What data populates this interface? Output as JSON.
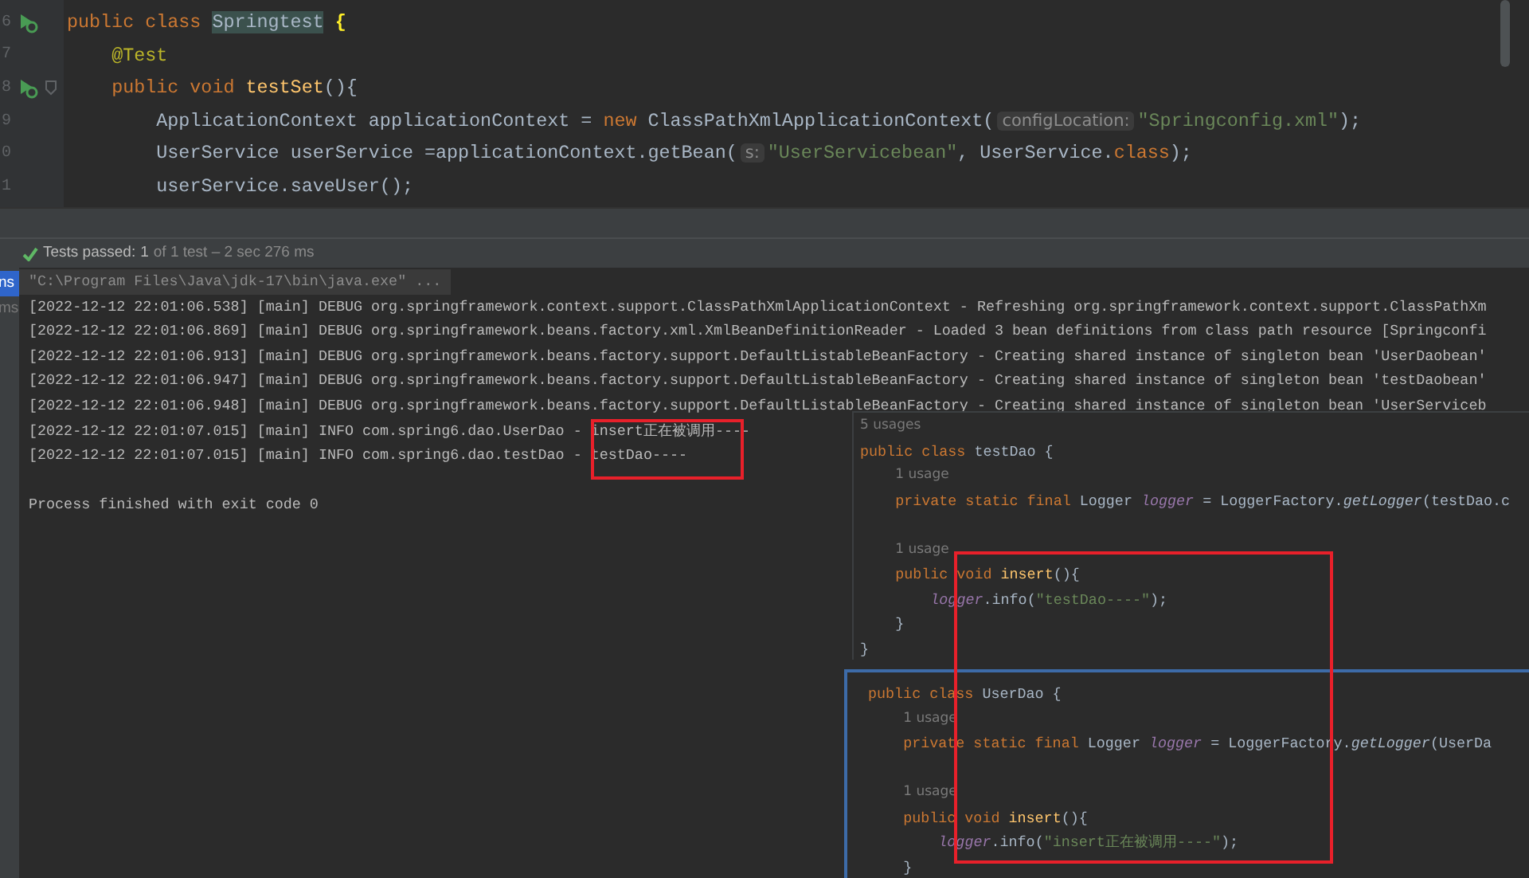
{
  "editor": {
    "lines": [
      {
        "number": "6",
        "run_marker": true,
        "fold": false,
        "tokens": [
          {
            "kind": "keyword",
            "text": "public class "
          },
          {
            "kind": "highlight",
            "text": "Springtest"
          },
          {
            "kind": "brace",
            "text": "{"
          }
        ],
        "children": [
          {
            "number": "7",
            "run_marker": false,
            "fold": false,
            "tokens": [
              {
                "kind": "annotation",
                "text": "@Test"
              }
            ]
          },
          {
            "number": "8",
            "run_marker": true,
            "fold": true,
            "tokens": [
              {
                "kind": "keyword",
                "text": "public void "
              },
              {
                "kind": "declaration",
                "text": "testSet"
              },
              {
                "kind": "plain",
                "text": "(){"
              }
            ],
            "children": [
              {
                "number": "9",
                "run_marker": false,
                "fold": false,
                "tokens": [
                  {
                    "kind": "plain",
                    "text": "ApplicationContext applicationContext = "
                  },
                  {
                    "kind": "keyword",
                    "text": "new "
                  },
                  {
                    "kind": "plain",
                    "text": "ClassPathXmlApplicationContext("
                  },
                  {
                    "kind": "hint",
                    "text": "configLocation:"
                  },
                  {
                    "kind": "string",
                    "text": "\"Springconfig.xml\""
                  },
                  {
                    "kind": "plain",
                    "text": ");"
                  }
                ]
              },
              {
                "number": "0",
                "run_marker": false,
                "fold": false,
                "tokens": [
                  {
                    "kind": "plain",
                    "text": "UserService userService =applicationContext.getBean("
                  },
                  {
                    "kind": "hint",
                    "text": "s:"
                  },
                  {
                    "kind": "string",
                    "text": "\"UserServicebean\""
                  },
                  {
                    "kind": "plain",
                    "text": ", UserService."
                  },
                  {
                    "kind": "keyword",
                    "text": "class"
                  },
                  {
                    "kind": "plain",
                    "text": ");"
                  }
                ]
              },
              {
                "number": "1",
                "run_marker": false,
                "fold": false,
                "tokens": [
                  {
                    "kind": "plain",
                    "text": "userService.saveUser();"
                  }
                ]
              }
            ]
          }
        ]
      }
    ]
  },
  "test_status": {
    "passed": true,
    "label": "Tests passed:",
    "count": "1",
    "detail": "of 1 test – 2 sec 276 ms"
  },
  "tree": [
    {
      "text": "ns",
      "selected": true
    },
    {
      "text": "ms",
      "selected": false
    }
  ],
  "console": [
    {
      "kind": "command",
      "text": "\"C:\\Program Files\\Java\\jdk-17\\bin\\java.exe\" ..."
    },
    {
      "kind": "log",
      "text": "[2022-12-12 22:01:06.538] [main] DEBUG org.springframework.context.support.ClassPathXmlApplicationContext - Refreshing org.springframework.context.support.ClassPathXm"
    },
    {
      "kind": "log",
      "text": "[2022-12-12 22:01:06.869] [main] DEBUG org.springframework.beans.factory.xml.XmlBeanDefinitionReader - Loaded 3 bean definitions from class path resource [Springconfi"
    },
    {
      "kind": "log",
      "text": "[2022-12-12 22:01:06.913] [main] DEBUG org.springframework.beans.factory.support.DefaultListableBeanFactory - Creating shared instance of singleton bean 'UserDaobean'"
    },
    {
      "kind": "log",
      "text": "[2022-12-12 22:01:06.947] [main] DEBUG org.springframework.beans.factory.support.DefaultListableBeanFactory - Creating shared instance of singleton bean 'testDaobean'"
    },
    {
      "kind": "log",
      "text": "[2022-12-12 22:01:06.948] [main] DEBUG org.springframework.beans.factory.support.DefaultListableBeanFactory - Creating shared instance of singleton bean 'UserServiceb"
    },
    {
      "kind": "log",
      "text": "[2022-12-12 22:01:07.015] [main] INFO com.spring6.dao.UserDao - insert正在被调用----"
    },
    {
      "kind": "log",
      "text": "[2022-12-12 22:01:07.015] [main] INFO com.spring6.dao.testDao - testDao----"
    },
    {
      "kind": "exit",
      "text": "Process finished with exit code 0"
    }
  ],
  "snippets": [
    {
      "focused": false,
      "lines": [
        {
          "kind": "usage",
          "text": "5 usages"
        },
        {
          "kind": "code",
          "tokens": [
            {
              "kind": "keyword",
              "text": "public class "
            },
            {
              "kind": "plain",
              "text": "testDao {"
            }
          ],
          "children": [
            {
              "kind": "usage",
              "text": "1 usage"
            },
            {
              "kind": "code",
              "tokens": [
                {
                  "kind": "keyword",
                  "text": "private static final "
                },
                {
                  "kind": "plain",
                  "text": "Logger "
                },
                {
                  "kind": "field",
                  "text": "logger"
                },
                {
                  "kind": "plain",
                  "text": " = LoggerFactory."
                },
                {
                  "kind": "static_call",
                  "text": "getLogger"
                },
                {
                  "kind": "plain",
                  "text": "(testDao.c"
                }
              ]
            },
            {
              "kind": "blank"
            },
            {
              "kind": "usage",
              "text": "1 usage"
            },
            {
              "kind": "code",
              "tokens": [
                {
                  "kind": "keyword",
                  "text": "public void "
                },
                {
                  "kind": "declaration",
                  "text": "insert"
                },
                {
                  "kind": "plain",
                  "text": "(){"
                }
              ],
              "children": [
                {
                  "kind": "code",
                  "tokens": [
                    {
                      "kind": "field",
                      "text": "logger"
                    },
                    {
                      "kind": "plain",
                      "text": ".info("
                    },
                    {
                      "kind": "string",
                      "text": "\"testDao----\""
                    },
                    {
                      "kind": "plain",
                      "text": ");"
                    }
                  ]
                }
              ]
            },
            {
              "kind": "code",
              "tokens": [
                {
                  "kind": "plain",
                  "text": "}"
                }
              ]
            }
          ]
        },
        {
          "kind": "code",
          "tokens": [
            {
              "kind": "plain",
              "text": "}"
            }
          ]
        }
      ]
    },
    {
      "focused": true,
      "lines": [
        {
          "kind": "code",
          "tokens": [
            {
              "kind": "keyword",
              "text": "public class "
            },
            {
              "kind": "plain",
              "text": "UserDao {"
            }
          ],
          "children": [
            {
              "kind": "usage",
              "text": "1 usage"
            },
            {
              "kind": "code",
              "tokens": [
                {
                  "kind": "keyword",
                  "text": "private static final "
                },
                {
                  "kind": "plain",
                  "text": "Logger "
                },
                {
                  "kind": "field",
                  "text": "logger"
                },
                {
                  "kind": "plain",
                  "text": " = LoggerFactory."
                },
                {
                  "kind": "static_call",
                  "text": "getLogger"
                },
                {
                  "kind": "plain",
                  "text": "(UserDa"
                }
              ]
            },
            {
              "kind": "blank"
            },
            {
              "kind": "usage",
              "text": "1 usage"
            },
            {
              "kind": "code",
              "tokens": [
                {
                  "kind": "keyword",
                  "text": "public void "
                },
                {
                  "kind": "declaration",
                  "text": "insert"
                },
                {
                  "kind": "plain",
                  "text": "(){"
                }
              ],
              "children": [
                {
                  "kind": "code",
                  "tokens": [
                    {
                      "kind": "field",
                      "text": "logger"
                    },
                    {
                      "kind": "plain",
                      "text": ".info("
                    },
                    {
                      "kind": "string",
                      "text": "\"insert正在被调用----\""
                    },
                    {
                      "kind": "plain",
                      "text": ");"
                    }
                  ]
                }
              ]
            },
            {
              "kind": "code",
              "tokens": [
                {
                  "kind": "plain",
                  "text": "}"
                }
              ]
            }
          ]
        }
      ]
    }
  ]
}
